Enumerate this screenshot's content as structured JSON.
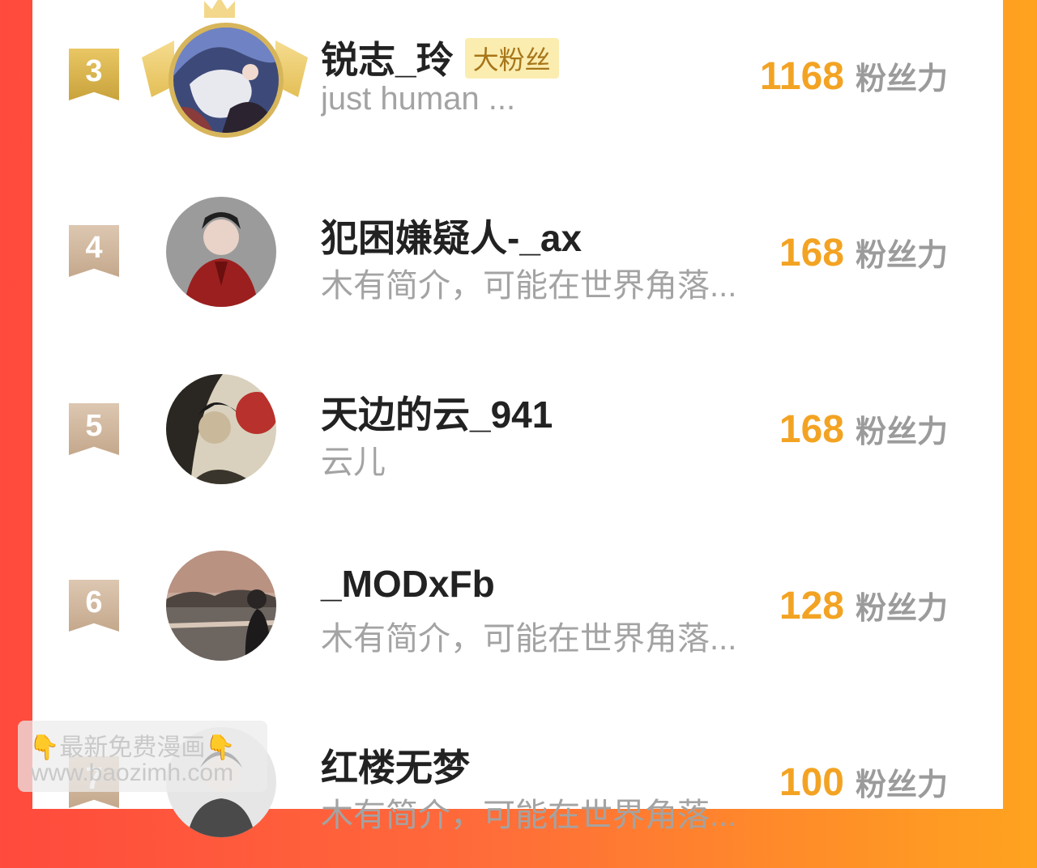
{
  "rows": [
    {
      "rank": "3",
      "name": "锐志_玲",
      "badge": "大粉丝",
      "bio": "just human ...",
      "score": "1168",
      "unit": "粉丝力"
    },
    {
      "rank": "4",
      "name": "犯困嫌疑人-_ax",
      "bio": "木有简介，可能在世界角落...",
      "score": "168",
      "unit": "粉丝力"
    },
    {
      "rank": "5",
      "name": "天边的云_941",
      "bio": "云儿",
      "score": "168",
      "unit": "粉丝力"
    },
    {
      "rank": "6",
      "name": "_MODxFb",
      "bio": "木有简介，可能在世界角落...",
      "score": "128",
      "unit": "粉丝力"
    },
    {
      "rank": "7",
      "name": "红楼无梦",
      "bio": "木有简介，可能在世界角落...",
      "score": "100",
      "unit": "粉丝力"
    }
  ],
  "watermark": {
    "line1": "最新免费漫画",
    "line2": "www.baozimh.com",
    "hand_icon": "pointing-down-icon"
  },
  "colors": {
    "score": "#f3a323",
    "gold_rank": "#d4af4a",
    "tan_rank": "#c9ad92",
    "badge_bg": "#fbedb0"
  }
}
